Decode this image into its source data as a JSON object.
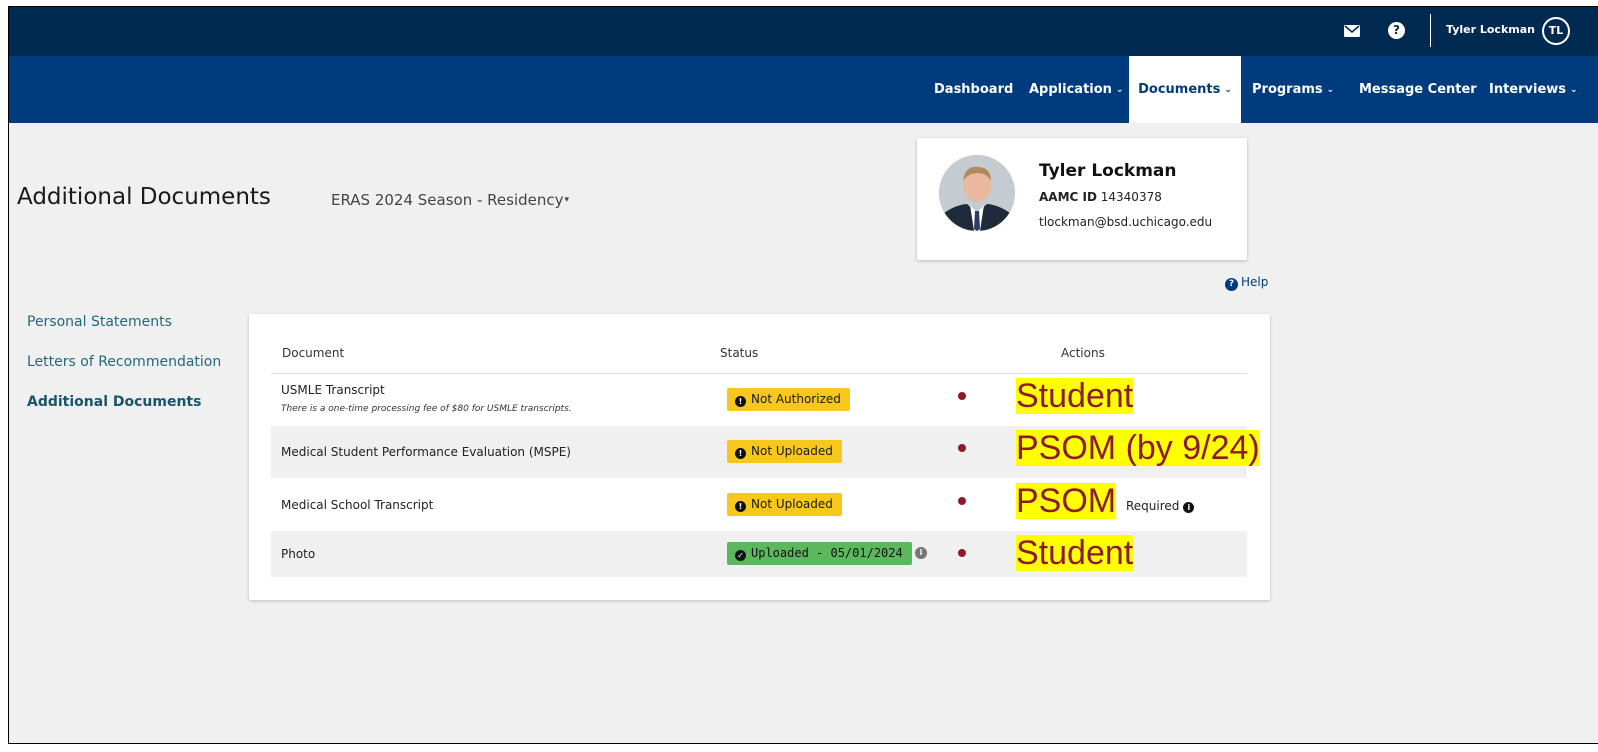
{
  "header": {
    "user_name": "Tyler Lockman",
    "user_initials": "TL",
    "mail_icon": "envelope-icon",
    "help_icon": "question-circle-icon"
  },
  "nav": {
    "items": [
      {
        "label": "Dashboard",
        "dropdown": false
      },
      {
        "label": "Application",
        "dropdown": true
      },
      {
        "label": "Documents",
        "dropdown": true,
        "active": true
      },
      {
        "label": "Programs",
        "dropdown": true
      },
      {
        "label": "Message Center",
        "dropdown": false
      },
      {
        "label": "Interviews",
        "dropdown": true
      }
    ]
  },
  "page": {
    "title": "Additional Documents",
    "season": "ERAS 2024 Season - Residency"
  },
  "profile": {
    "name": "Tyler Lockman",
    "aamc_label": "AAMC ID",
    "aamc_id": "14340378",
    "email": "tlockman@bsd.uchicago.edu"
  },
  "help_label": "Help",
  "sidebar": {
    "items": [
      {
        "label": "Personal Statements",
        "active": false
      },
      {
        "label": "Letters of Recommendation",
        "active": false
      },
      {
        "label": "Additional Documents",
        "active": true
      }
    ]
  },
  "table": {
    "headers": {
      "document": "Document",
      "status": "Status",
      "actions": "Actions"
    },
    "rows": [
      {
        "document": "USMLE Transcript",
        "note": "There is a one-time processing fee of $80 for USMLE transcripts.",
        "status": "Not Authorized",
        "annotation": "Student"
      },
      {
        "document": "Medical Student Performance Evaluation (MSPE)",
        "status": "Not Uploaded",
        "annotation": "PSOM (by 9/24)"
      },
      {
        "document": "Medical School Transcript",
        "status": "Not Uploaded",
        "annotation": "PSOM",
        "required": "Required"
      },
      {
        "document": "Photo",
        "status": "Uploaded - 05/01/2024",
        "annotation": "Student"
      }
    ]
  },
  "colors": {
    "topbar": "#002a52",
    "navbar": "#003c7d",
    "warning_badge": "#f7c71c",
    "success_badge": "#5cb85c",
    "annotation_text": "#8b1a2b",
    "annotation_highlight": "#ffff00"
  }
}
